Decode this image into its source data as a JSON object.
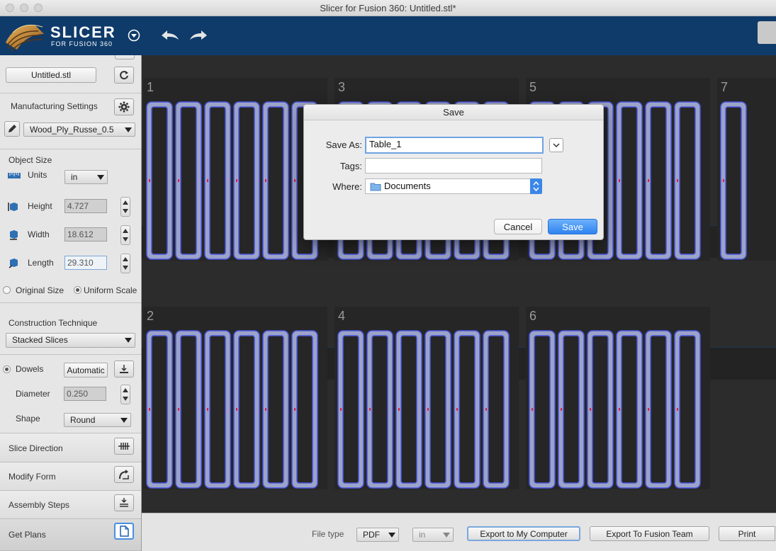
{
  "window": {
    "title": "Slicer for Fusion 360: Untitled.stl*"
  },
  "header": {
    "brand": "SLICER",
    "brand_sub": "FOR FUSION 360"
  },
  "sidebar": {
    "file_name": "Untitled.stl",
    "manufacturing": {
      "label": "Manufacturing Settings",
      "material": "Wood_Ply_Russe_0.5"
    },
    "object_size": {
      "label": "Object Size",
      "units_label": "Units",
      "units_value": "in",
      "height_label": "Height",
      "height_value": "4.727",
      "width_label": "Width",
      "width_value": "18.612",
      "length_label": "Length",
      "length_value": "29.310",
      "original_size": "Original Size",
      "uniform_scale": "Uniform Scale"
    },
    "construction": {
      "label": "Construction Technique",
      "value": "Stacked Slices"
    },
    "dowels": {
      "label": "Dowels",
      "mode": "Automatic",
      "diameter_label": "Diameter",
      "diameter_value": "0.250",
      "shape_label": "Shape",
      "shape_value": "Round"
    },
    "slice_direction": "Slice Direction",
    "modify_form": "Modify Form",
    "assembly_steps": "Assembly Steps",
    "get_plans": "Get Plans"
  },
  "sheets": [
    "1",
    "3",
    "5",
    "7",
    "2",
    "4",
    "6"
  ],
  "bottom": {
    "file_type_label": "File type",
    "file_type_value": "PDF",
    "unit_value": "in",
    "export_computer": "Export to My Computer",
    "export_fusion": "Export To Fusion Team",
    "print": "Print"
  },
  "dialog": {
    "title": "Save",
    "save_as_label": "Save As:",
    "save_as_value": "Table_1",
    "tags_label": "Tags:",
    "tags_value": "",
    "where_label": "Where:",
    "where_value": "Documents",
    "cancel": "Cancel",
    "save": "Save"
  },
  "colors": {
    "header_bg": "#0f3b6a",
    "slice_stroke": "#4a57e0",
    "slice_fill": "#9ca3c8",
    "accent": "#3c89ea"
  }
}
